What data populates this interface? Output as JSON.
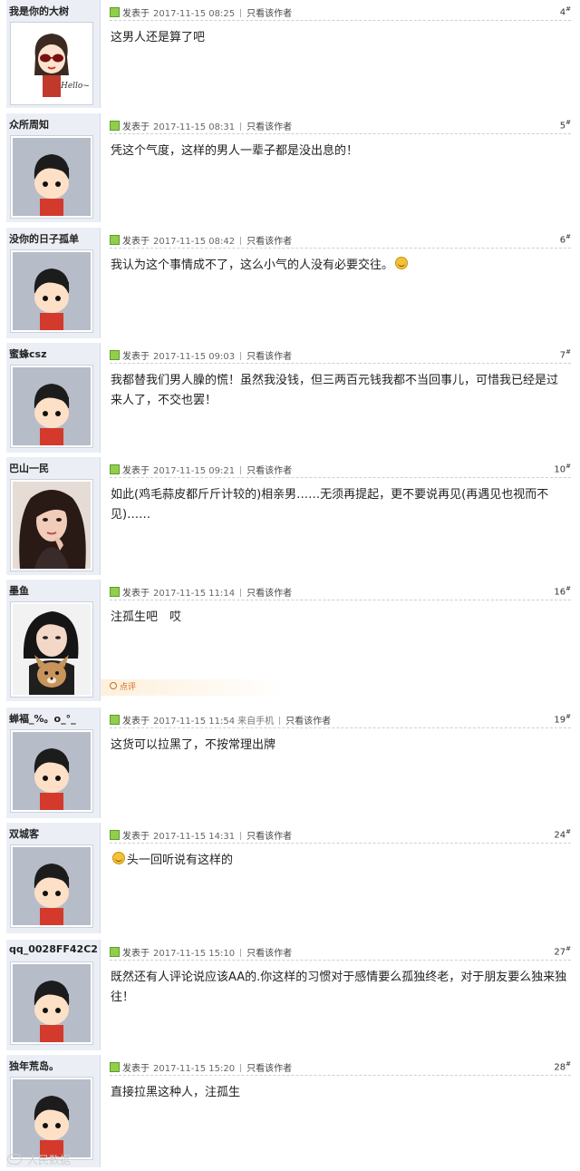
{
  "labels": {
    "posted": "发表于",
    "only_author": "只看该作者",
    "comment": "点评"
  },
  "posts": [
    {
      "user": "我是你的大树",
      "time": "2017-11-15 08:25",
      "floor": "4",
      "content": "这男人还是算了吧",
      "avatar": "hello-girl"
    },
    {
      "user": "众所周知",
      "time": "2017-11-15 08:31",
      "floor": "5",
      "content": "凭这个气度，这样的男人一辈子都是没出息的！",
      "avatar": "default-cartoon"
    },
    {
      "user": "没你的日子孤单",
      "time": "2017-11-15 08:42",
      "floor": "6",
      "content": "我认为这个事情成不了，这么小气的人没有必要交往。",
      "avatar": "default-cartoon"
    },
    {
      "user": "蜜蜂csz",
      "time": "2017-11-15 09:03",
      "floor": "7",
      "content": "我都替我们男人臊的慌！虽然我没钱，但三两百元钱我都不当回事儿，可惜我已经是过来人了，不交也罢！",
      "avatar": "default-cartoon"
    },
    {
      "user": "巴山一民",
      "time": "2017-11-15 09:21",
      "floor": "10",
      "content": "如此(鸡毛蒜皮都斤斤计较的)相亲男……无须再提起，更不要说再见(再遇见也视而不见)……",
      "avatar": "woman-photo"
    },
    {
      "user": "墨鱼",
      "time": "2017-11-15 11:14",
      "floor": "16",
      "content": "注孤生吧　哎",
      "avatar": "girl-dog-photo"
    },
    {
      "user": "蝉褔_%。o_°_",
      "time": "2017-11-15 11:54",
      "source": "来自手机",
      "floor": "19",
      "content": "这货可以拉黑了，不按常理出牌",
      "avatar": "default-cartoon"
    },
    {
      "user": "双城客",
      "time": "2017-11-15 14:31",
      "floor": "24",
      "content": "头一回听说有这样的",
      "avatar": "default-cartoon"
    },
    {
      "user": "qq_0028FF42C2",
      "time": "2017-11-15 15:10",
      "floor": "27",
      "content": "既然还有人评论说应该AA的.你这样的习惯对于感情要么孤独终老，对于朋友要么独来独往！",
      "avatar": "default-cartoon"
    },
    {
      "user": "独年荒岛。",
      "time": "2017-11-15 15:20",
      "floor": "28",
      "content": "直接拉黑这种人，注孤生",
      "avatar": "default-cartoon"
    }
  ],
  "watermark": "人民数据"
}
